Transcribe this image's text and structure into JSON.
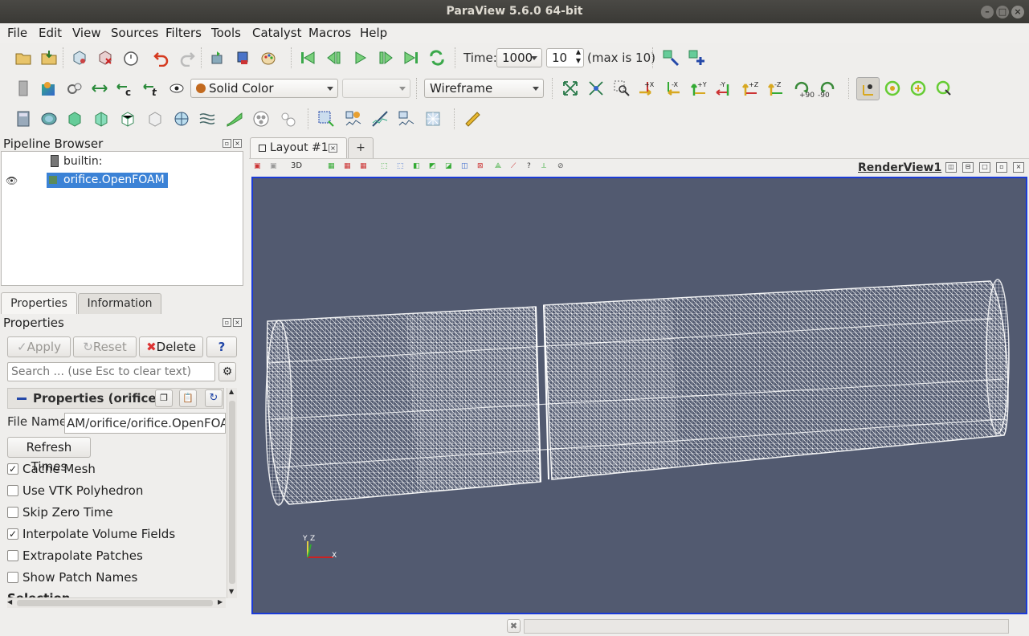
{
  "window": {
    "title": "ParaView 5.6.0 64-bit"
  },
  "menu": [
    "File",
    "Edit",
    "View",
    "Sources",
    "Filters",
    "Tools",
    "Catalyst",
    "Macros",
    "Help"
  ],
  "time_toolbar": {
    "time_label": "Time:",
    "time_value": "1000",
    "step_value": "10",
    "max_label": "(max is 10)"
  },
  "display_toolbar": {
    "color_by": "Solid Color",
    "component": "",
    "representation": "Wireframe"
  },
  "camera_labels": [
    "+X",
    "-X",
    "+Y",
    "-Y",
    "+Z",
    "-Z",
    "+90",
    "-90"
  ],
  "pipeline": {
    "title": "Pipeline Browser",
    "items": [
      {
        "label": "builtin:"
      },
      {
        "label": "orifice.OpenFOAM"
      }
    ]
  },
  "tabs": {
    "properties": "Properties",
    "information": "Information"
  },
  "properties": {
    "title": "Properties",
    "apply": "Apply",
    "reset": "Reset",
    "delete": "Delete",
    "help": "?",
    "search_placeholder": "Search ... (use Esc to clear text)",
    "section": "Properties (orifice.",
    "file_name_label": "File Name",
    "file_name_value": "AM/orifice/orifice.OpenFOAM",
    "refresh_times": "Refresh Times",
    "checkboxes": [
      {
        "label": "Cache Mesh",
        "checked": "✓"
      },
      {
        "label": "Use VTK Polyhedron",
        "checked": ""
      },
      {
        "label": "Skip Zero Time",
        "checked": ""
      },
      {
        "label": "Interpolate Volume Fields",
        "checked": "✓"
      },
      {
        "label": "Extrapolate Patches",
        "checked": ""
      },
      {
        "label": "Show Patch Names",
        "checked": ""
      }
    ],
    "partial_next": "Selection"
  },
  "layout": {
    "tab_label": "Layout #1",
    "add_tab": "+",
    "view_name": "RenderView1",
    "view_3d": "3D"
  },
  "orientation_axes": {
    "y": "Y",
    "z": "Z",
    "x": "X"
  },
  "colors": {
    "viewport_bg": "#525a70",
    "selection": "#3b82d6",
    "active_border": "#1b3bd6"
  }
}
